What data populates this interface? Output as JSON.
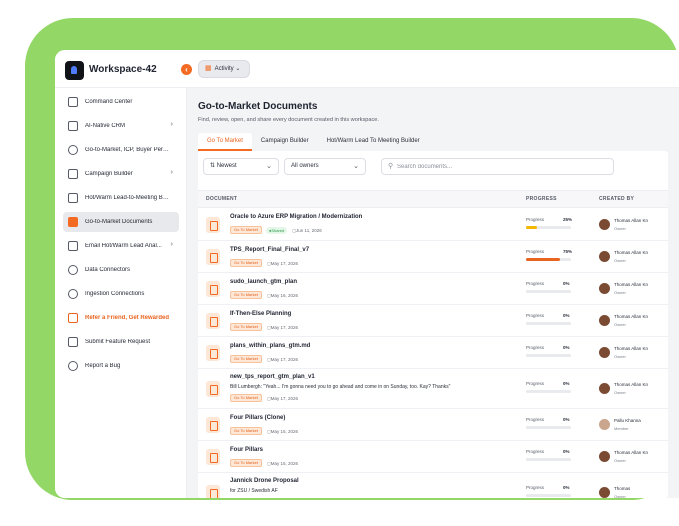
{
  "topbar": {
    "workspace_name": "Workspace-42",
    "activity_label": "Activity"
  },
  "sidebar": {
    "items": [
      {
        "label": "Command Center",
        "icon": "home-icon"
      },
      {
        "label": "AI-Native CRM",
        "icon": "crm-icon",
        "chevron": true
      },
      {
        "label": "Go-to-Market, ICP, Buyer Perso...",
        "icon": "users-icon"
      },
      {
        "label": "Campaign Builder",
        "icon": "megaphone-icon",
        "chevron": true
      },
      {
        "label": "Hot/Warm Lead-to-Meeting Bu...",
        "icon": "document-icon"
      },
      {
        "label": "Go-to-Market Documents",
        "icon": "documents-icon",
        "active": true
      },
      {
        "label": "Email Hot/Warm Lead Anal...",
        "icon": "bar-chart-icon",
        "chevron": true
      },
      {
        "label": "Data Connectors",
        "icon": "connectors-icon"
      },
      {
        "label": "Ingestion Connections",
        "icon": "database-icon"
      },
      {
        "label": "Refer a Friend, Get Rewarded",
        "icon": "gift-icon",
        "highlight": true
      },
      {
        "label": "Submit Feature Request",
        "icon": "edit-icon"
      },
      {
        "label": "Report a Bug",
        "icon": "bug-icon"
      }
    ]
  },
  "main": {
    "title": "Go-to-Market Documents",
    "subtitle": "Find, review, open, and share every document created in this workspace.",
    "tabs": [
      "Go To Market",
      "Campaign Builder",
      "Hot/Warm Lead To Meeting Builder"
    ],
    "filters": {
      "sort_value": "Newest",
      "owner_value": "All owners",
      "search_placeholder": "Search documents..."
    },
    "table": {
      "columns": [
        "DOCUMENT",
        "PROGRESS",
        "CREATED BY"
      ],
      "progress_label": "Progress",
      "rows": [
        {
          "title": "Oracle to Azure ERP Migration / Modernization",
          "badge": "Go To Market",
          "shared": "Shared",
          "date": "Jun 11, 2026",
          "percent": "25%",
          "progress": 0.25,
          "creator": "Thomas Allan Kn",
          "role": "Owner"
        },
        {
          "title": "TPS_Report_Final_Final_v7",
          "badge": "Go To Market",
          "date": "May 17, 2026",
          "percent": "75%",
          "progress": 0.75,
          "creator": "Thomas Allan Kn",
          "role": "Owner"
        },
        {
          "title": "sudo_launch_gtm_plan",
          "badge": "Go To Market",
          "date": "May 16, 2026",
          "percent": "0%",
          "progress": 0,
          "creator": "Thomas Allan Kn",
          "role": "Owner"
        },
        {
          "title": "If-Then-Else Planning",
          "badge": "Go To Market",
          "date": "May 17, 2026",
          "percent": "0%",
          "progress": 0,
          "creator": "Thomas Allan Kn",
          "role": "Owner"
        },
        {
          "title": "plans_within_plans_gtm.md",
          "badge": "Go To Market",
          "date": "May 17, 2026",
          "percent": "0%",
          "progress": 0,
          "creator": "Thomas Allan Kn",
          "role": "Owner"
        },
        {
          "title": "new_tps_report_gtm_plan_v1",
          "desc": "Bill Lumbergh: \"Yeah... I'm gonna need you to go ahead and come in on Sunday, too. Kay? Thanks\"",
          "badge": "Go To Market",
          "date": "May 17, 2026",
          "percent": "0%",
          "progress": 0,
          "creator": "Thomas Allan Kn",
          "role": "Owner"
        },
        {
          "title": "Four Pillars (Clone)",
          "badge": "Go To Market",
          "date": "May 15, 2026",
          "percent": "0%",
          "progress": 0,
          "creator": "Pallu Khanna",
          "role": "Member",
          "light": true
        },
        {
          "title": "Four Pillars",
          "badge": "Go To Market",
          "date": "May 15, 2026",
          "percent": "0%",
          "progress": 0,
          "creator": "Thomas Allan Kn",
          "role": "Owner"
        },
        {
          "title": "Jannick Drone Proposal",
          "desc": "for ZSU / Swedish AF",
          "date": "",
          "percent": "0%",
          "progress": 0,
          "creator": "Thomas",
          "role": "Owner"
        }
      ]
    }
  },
  "colors": {
    "accent": "#f36b22",
    "frame_green": "#93d767",
    "progress_25": "#f5b800",
    "progress_75": "#e8641f"
  }
}
